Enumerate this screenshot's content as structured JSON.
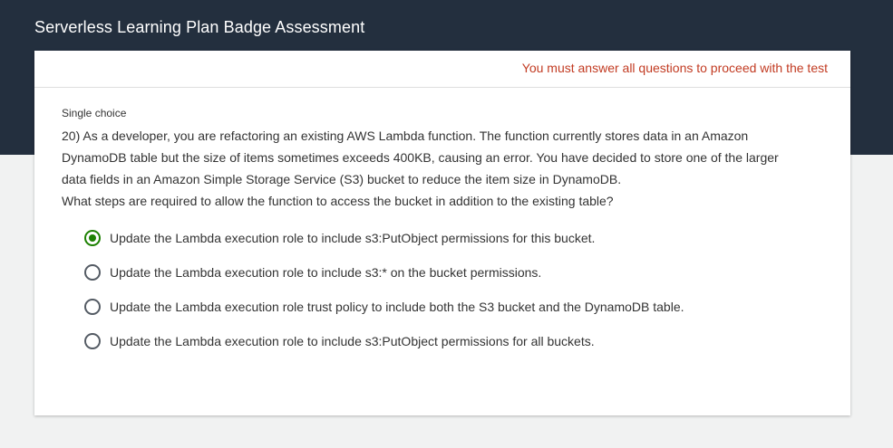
{
  "header": {
    "title": "Serverless Learning Plan Badge Assessment"
  },
  "card": {
    "warning": "You must answer all questions to proceed with the test"
  },
  "question": {
    "type_label": "Single choice",
    "lines": [
      "20) As a developer, you are refactoring an existing AWS Lambda function. The function currently stores data in an Amazon",
      "DynamoDB table but the size of items sometimes exceeds 400KB, causing an error. You have decided to store one of the larger",
      "data fields in an Amazon Simple Storage Service (S3) bucket to reduce the item size in DynamoDB.",
      "What steps are required to allow the function to access the bucket in addition to the existing table?"
    ],
    "options": [
      {
        "label": "Update the Lambda execution role to include s3:PutObject permissions for this bucket.",
        "selected": true
      },
      {
        "label": "Update the Lambda execution role to include s3:* on the bucket permissions.",
        "selected": false
      },
      {
        "label": "Update the Lambda execution role trust policy to include both the S3 bucket and the DynamoDB table.",
        "selected": false
      },
      {
        "label": "Update the Lambda execution role to include s3:PutObject permissions for all buckets.",
        "selected": false
      }
    ]
  },
  "colors": {
    "header_bg": "#232f3e",
    "warning": "#c23b22",
    "selected_radio": "#1d8102"
  }
}
